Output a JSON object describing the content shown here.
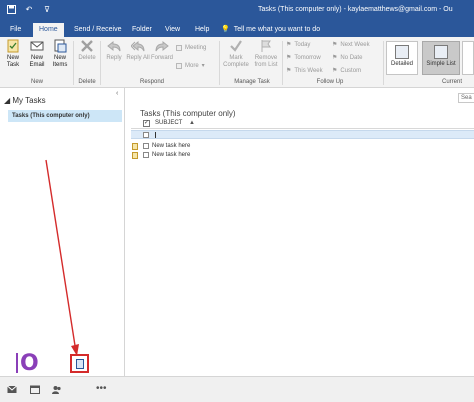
{
  "window": {
    "title": "Tasks (This computer only)  -  kaylaematthews@gmail.com  -  Ou"
  },
  "tabs": [
    {
      "label": "File"
    },
    {
      "label": "Home"
    },
    {
      "label": "Send / Receive"
    },
    {
      "label": "Folder"
    },
    {
      "label": "View"
    },
    {
      "label": "Help"
    }
  ],
  "tellme": {
    "icon": "lightbulb-icon",
    "label": "Tell me what you want to do"
  },
  "ribbon": {
    "new": {
      "task": "New Task",
      "email": "New Email",
      "items": "New Items",
      "group": "New"
    },
    "delete": {
      "label": "Delete",
      "group": "Delete"
    },
    "respond": {
      "reply": "Reply",
      "reply_all": "Reply All",
      "forward": "Forward",
      "meeting": "Meeting",
      "more": "More",
      "group": "Respond"
    },
    "manage": {
      "mark_complete": "Mark Complete",
      "remove_list": "Remove from List",
      "group": "Manage Task"
    },
    "followup": {
      "today": "Today",
      "tomorrow": "Tomorrow",
      "this_week": "This Week",
      "next_week": "Next Week",
      "no_date": "No Date",
      "custom": "Custom",
      "group": "Follow Up"
    },
    "current_view": {
      "detailed": "Detailed",
      "simple_list": "Simple List",
      "group": "Current"
    }
  },
  "folders": {
    "header": "My Tasks",
    "selected": "Tasks (This computer only)"
  },
  "tasklist": {
    "title": "Tasks (This computer only)",
    "column_subject": "SUBJECT",
    "tasks": [
      "New task here",
      "New task here"
    ],
    "search_placeholder": "Sea"
  },
  "colors": {
    "accent": "#2b579a",
    "highlight": "#cde6f7",
    "annotation": "#d42b2b",
    "logo": "#8a3fb8"
  }
}
